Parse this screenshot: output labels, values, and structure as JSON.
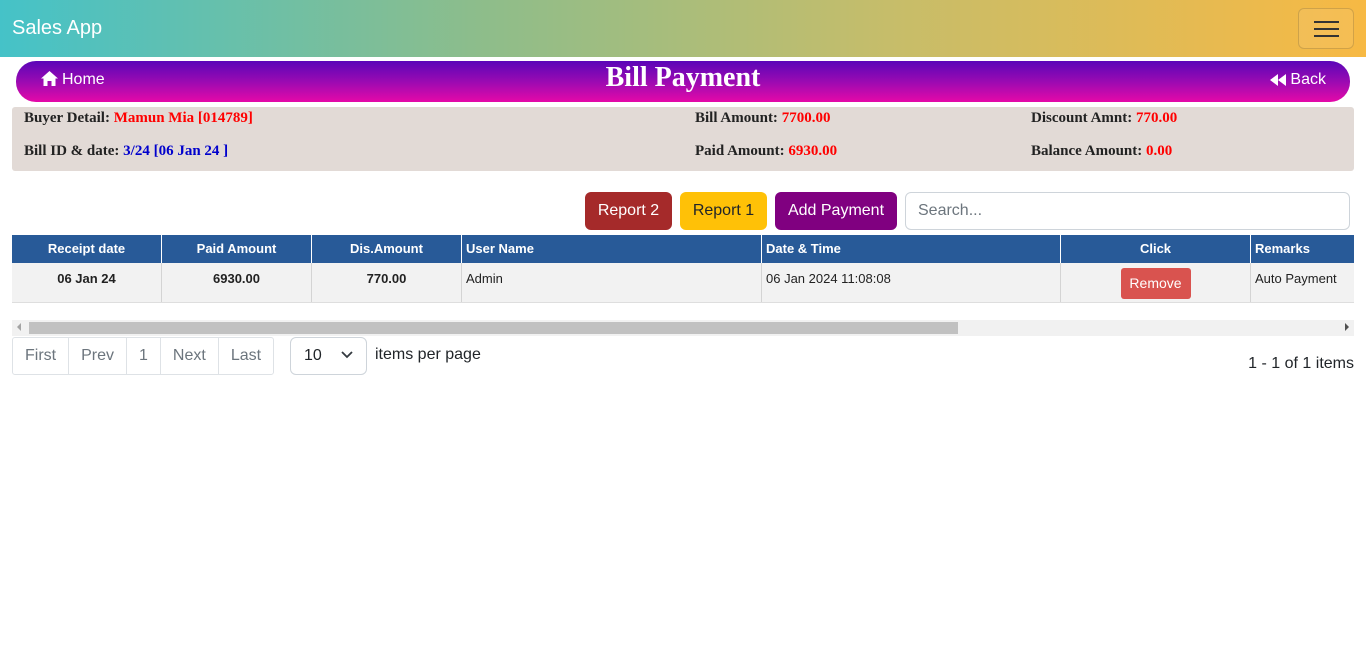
{
  "app": {
    "title": "Sales App"
  },
  "nav": {
    "home_label": "Home",
    "back_label": "Back",
    "page_title": "Bill Payment"
  },
  "bill": {
    "buyer_label": "Buyer Detail:",
    "buyer_value": "Mamun Mia [014789]",
    "bill_id_label": "Bill ID & date:",
    "bill_id_value": "3/24 [06 Jan 24 ]",
    "bill_amount_label": "Bill Amount:",
    "bill_amount_value": "7700.00",
    "paid_amount_label": "Paid Amount:",
    "paid_amount_value": "6930.00",
    "discount_label": "Discount Amnt:",
    "discount_value": "770.00",
    "balance_label": "Balance Amount:",
    "balance_value": "0.00"
  },
  "actions": {
    "report2_label": "Report 2",
    "report1_label": "Report 1",
    "add_payment_label": "Add Payment",
    "search_placeholder": "Search..."
  },
  "table": {
    "columns": [
      "Receipt date",
      "Paid Amount",
      "Dis.Amount",
      "User Name",
      "Date & Time",
      "Click",
      "Remarks"
    ],
    "rows": [
      {
        "receipt_date": "06 Jan 24",
        "paid_amount": "6930.00",
        "dis_amount": "770.00",
        "user_name": "Admin",
        "date_time": "06 Jan 2024 11:08:08",
        "action_label": "Remove",
        "remarks": "Auto Payment"
      }
    ]
  },
  "pagination": {
    "first": "First",
    "prev": "Prev",
    "page": "1",
    "next": "Next",
    "last": "Last",
    "page_size": "10",
    "per_page_label": "items per page",
    "summary": "1 - 1 of 1 items"
  },
  "colors": {
    "header_gradient": [
      "#45c2c8",
      "#f7b944"
    ],
    "title_gradient": [
      "#5a06b8",
      "#e509a8"
    ],
    "table_header": "#285a98",
    "report2_button": "#a52a2a",
    "report1_button": "#ffc107",
    "add_payment_button": "#800080",
    "remove_button": "#d9534f"
  },
  "icons": [
    "menu-icon",
    "home-icon",
    "backward-icon",
    "chevron-down-icon"
  ]
}
